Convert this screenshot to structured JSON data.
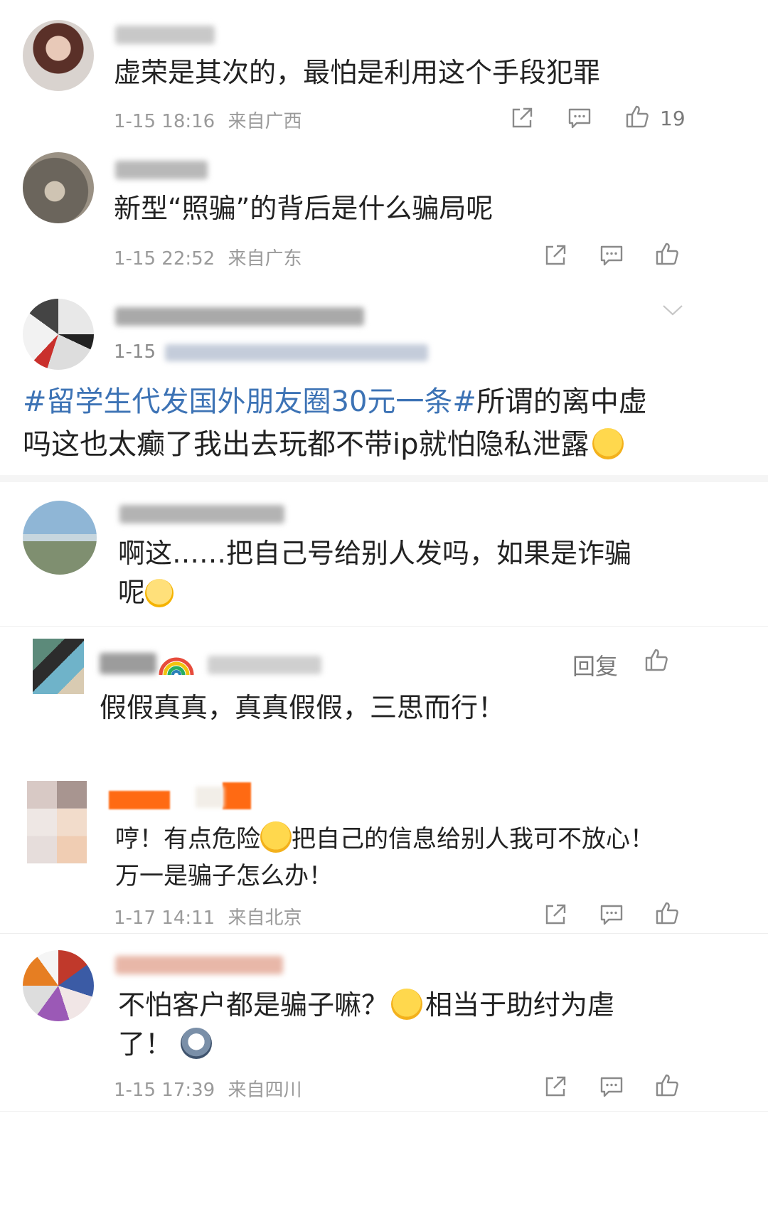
{
  "comments": [
    {
      "text": "虚荣是其次的，最怕是利用这个手段犯罪",
      "date": "1-15 18:16",
      "location": "来自广西",
      "likes": "19"
    },
    {
      "text": "新型“照骗”的背后是什么骗局呢",
      "date": "1-15 22:52",
      "location": "来自广东"
    },
    {
      "date": "1-15",
      "hashtag": "#留学生代发国外朋友圈30元一条#",
      "text_line1_rest": "所谓的离中虚",
      "text_line2": "吗这也太癫了我出去玩都不带ip就怕隐私泄露"
    },
    {
      "text_line1": "啊这……把自己号给别人发吗，如果是诈骗",
      "text_line2": "呢"
    },
    {
      "reply_label": "回复",
      "text": "假假真真，真真假假，三思而行！"
    },
    {
      "text_line1_a": "哼！有点危险",
      "text_line1_b": "把自己的信息给别人我可不放心！",
      "text_line2": "万一是骗子怎么办！",
      "date": "1-17 14:11",
      "location": "来自北京"
    },
    {
      "text_line1_a": "不怕客户都是骗子嘛？",
      "text_line1_b": "相当于助纣为虐",
      "text_line2": "了！",
      "date": "1-15 17:39",
      "location": "来自四川"
    }
  ],
  "icons": {
    "share": "share-icon",
    "comment": "comment-icon",
    "like": "thumbs-up-icon",
    "chevron": "chevron-down-icon"
  },
  "colors": {
    "hashtag": "#3d73b5",
    "meta": "#9a9a9a",
    "accent_bar": "#ff6a13"
  }
}
